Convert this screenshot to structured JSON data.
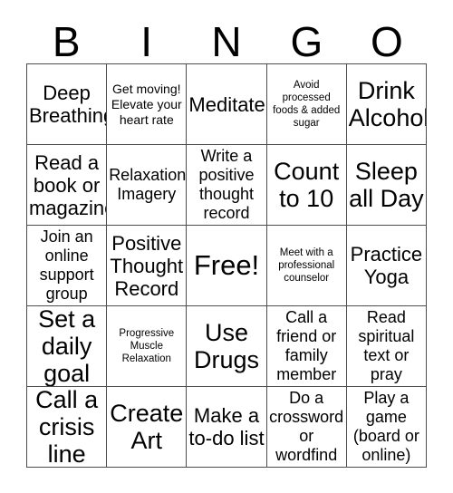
{
  "header": {
    "letters": [
      "B",
      "I",
      "N",
      "G",
      "O"
    ]
  },
  "grid": {
    "rows": [
      [
        {
          "text": "Deep Breathing",
          "size": "t-lg"
        },
        {
          "text": "Get moving! Elevate your heart rate",
          "size": "t-sm"
        },
        {
          "text": "Meditate",
          "size": "t-lg"
        },
        {
          "text": "Avoid processed foods & added sugar",
          "size": "t-xs"
        },
        {
          "text": "Drink Alcohol",
          "size": "t-xl"
        }
      ],
      [
        {
          "text": "Read a book or magazine",
          "size": "t-lg"
        },
        {
          "text": "Relaxation Imagery",
          "size": "t-md"
        },
        {
          "text": "Write a positive thought record",
          "size": "t-md"
        },
        {
          "text": "Count to 10",
          "size": "t-xl"
        },
        {
          "text": "Sleep all Day",
          "size": "t-xl"
        }
      ],
      [
        {
          "text": "Join an online support group",
          "size": "t-md"
        },
        {
          "text": "Positive Thought Record",
          "size": "t-lg"
        },
        {
          "text": "Free!",
          "size": "t-free"
        },
        {
          "text": "Meet with a professional counselor",
          "size": "t-xs"
        },
        {
          "text": "Practice Yoga",
          "size": "t-lg"
        }
      ],
      [
        {
          "text": "Set a daily goal",
          "size": "t-xl"
        },
        {
          "text": "Progressive Muscle Relaxation",
          "size": "t-xs"
        },
        {
          "text": "Use Drugs",
          "size": "t-xl"
        },
        {
          "text": "Call a friend or family member",
          "size": "t-md"
        },
        {
          "text": "Read spiritual text or pray",
          "size": "t-md"
        }
      ],
      [
        {
          "text": "Call a crisis line",
          "size": "t-xl"
        },
        {
          "text": "Create Art",
          "size": "t-xl"
        },
        {
          "text": "Make a to-do list",
          "size": "t-lg"
        },
        {
          "text": "Do a crossword or wordfind",
          "size": "t-md"
        },
        {
          "text": "Play a game (board or online)",
          "size": "t-md"
        }
      ]
    ]
  },
  "colors": {
    "border": "#4d4d4d",
    "text": "#000000",
    "background": "#ffffff"
  }
}
